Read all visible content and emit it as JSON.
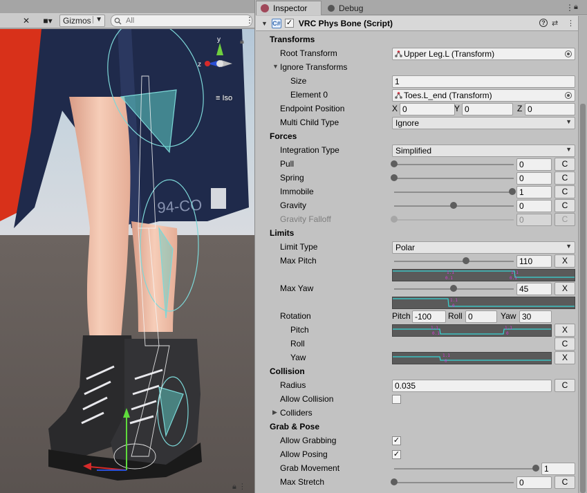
{
  "scene": {
    "toolbar": {
      "tools_icon": "tools-icon",
      "camera_icon": "camera-icon",
      "gizmos_label": "Gizmos",
      "search_placeholder": "All"
    },
    "axis_label_y": "y",
    "axis_label_z": "z",
    "iso_label": "Iso",
    "skirt_text": "94-CO"
  },
  "inspector": {
    "tabs": [
      {
        "label": "Inspector",
        "icon": "inspector-icon"
      },
      {
        "label": "Debug",
        "icon": "debug-icon"
      }
    ],
    "component": {
      "title": "VRC Phys Bone (Script)",
      "enabled": true,
      "enabled_mark": "✓"
    },
    "sections": {
      "transforms": "Transforms",
      "forces": "Forces",
      "limits": "Limits",
      "collision": "Collision",
      "grab_pose": "Grab & Pose"
    },
    "transforms": {
      "root_label": "Root Transform",
      "root_value": "Upper Leg.L (Transform)",
      "ignore_label": "Ignore Transforms",
      "size_label": "Size",
      "size_value": "1",
      "element0_label": "Element 0",
      "element0_value": "Toes.L_end (Transform)",
      "endpoint_label": "Endpoint Position",
      "endpoint": {
        "x_label": "X",
        "x": "0",
        "y_label": "Y",
        "y": "0",
        "z_label": "Z",
        "z": "0"
      },
      "multichild_label": "Multi Child Type",
      "multichild_value": "Ignore"
    },
    "forces": {
      "integration_label": "Integration Type",
      "integration_value": "Simplified",
      "c_label": "C",
      "rows": [
        {
          "label": "Pull",
          "value": "0",
          "level": 0,
          "enabled": true
        },
        {
          "label": "Spring",
          "value": "0",
          "level": 0,
          "enabled": true
        },
        {
          "label": "Immobile",
          "value": "1",
          "level": 1,
          "enabled": true
        },
        {
          "label": "Gravity",
          "value": "0",
          "level": 0.5,
          "enabled": true
        },
        {
          "label": "Gravity Falloff",
          "value": "0",
          "level": 0,
          "enabled": false
        }
      ]
    },
    "limits": {
      "type_label": "Limit Type",
      "type_value": "Polar",
      "x_label": "X",
      "max_pitch_label": "Max Pitch",
      "max_pitch_value": "110",
      "max_pitch_level": 0.61,
      "max_yaw_label": "Max Yaw",
      "max_yaw_value": "45",
      "max_yaw_level": 0.5,
      "rotation_label": "Rotation",
      "rotation": {
        "pitch_label": "Pitch",
        "pitch": "-100",
        "roll_label": "Roll",
        "roll": "0",
        "yaw_label": "Yaw",
        "yaw": "30"
      },
      "pitch_label": "Pitch",
      "roll_label": "Roll",
      "yaw_label": "Yaw",
      "c_label": "C"
    },
    "collision": {
      "radius_label": "Radius",
      "radius_value": "0.035",
      "allow_label": "Allow Collision",
      "allow_checked": false,
      "colliders_label": "Colliders",
      "c_label": "C"
    },
    "grab": {
      "allow_grabbing_label": "Allow Grabbing",
      "allow_grabbing_mark": "✓",
      "allow_posing_label": "Allow Posing",
      "allow_posing_mark": "✓",
      "grab_movement_label": "Grab Movement",
      "grab_movement_value": "1",
      "grab_movement_level": 1,
      "max_stretch_label": "Max Stretch",
      "max_stretch_value": "0",
      "max_stretch_level": 0,
      "c_label": "C"
    }
  },
  "colors": {
    "curve_line": "#38d6d6",
    "curve_marker": "#d63cd6",
    "inspector_bg": "#c2c2c2",
    "header_bg": "#d8d8d8"
  }
}
